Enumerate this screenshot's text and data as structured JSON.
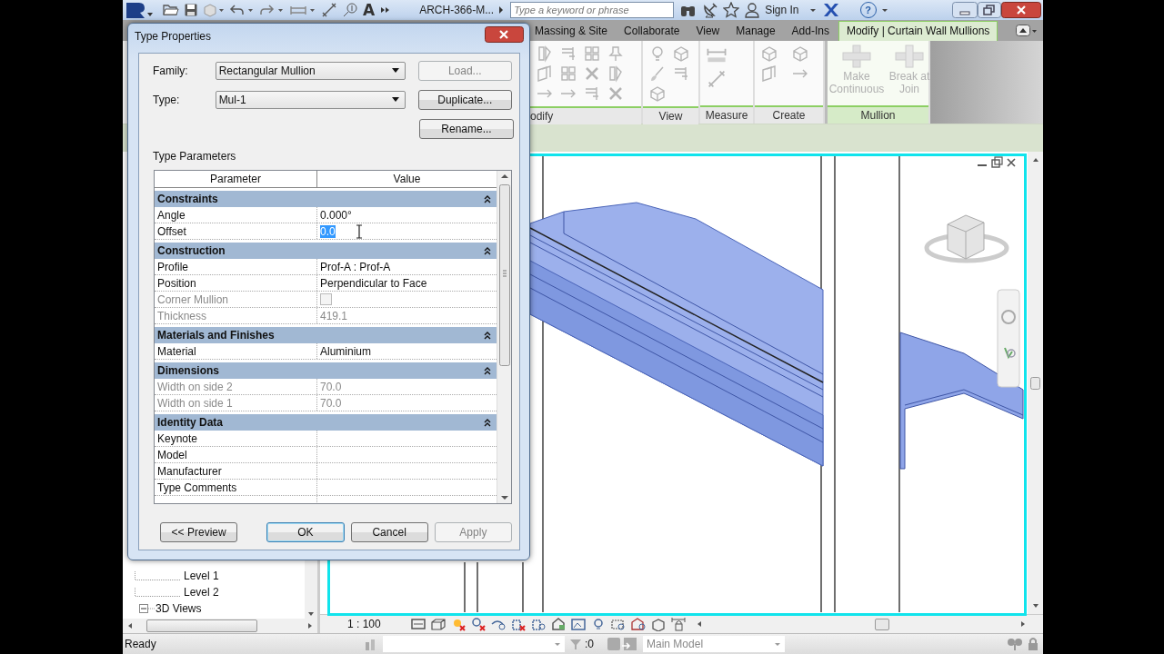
{
  "title_bar": {
    "quick_access": {
      "text_tool": "A"
    },
    "title": "ARCH-366-M...",
    "search": {
      "placeholder": "Type a keyword or phrase"
    },
    "sign_in": "Sign In",
    "help": "?"
  },
  "ribbon": {
    "tabs": [
      {
        "label": "Massing & Site",
        "selected": false
      },
      {
        "label": "Collaborate",
        "selected": false
      },
      {
        "label": "View",
        "selected": false
      },
      {
        "label": "Manage",
        "selected": false
      },
      {
        "label": "Add-Ins",
        "selected": false
      },
      {
        "label": "Modify | Curtain Wall Mullions",
        "selected": true
      }
    ],
    "panels": [
      {
        "label": "odify",
        "kind": "modify"
      },
      {
        "label": "View",
        "kind": "view"
      },
      {
        "label": "Measure",
        "kind": "measure"
      },
      {
        "label": "Create",
        "kind": "create"
      },
      {
        "label": "Mullion",
        "kind": "mullion",
        "buttons": [
          {
            "label": "Make Continuous",
            "disabled": true
          },
          {
            "label": "Break at Join",
            "disabled": true
          }
        ]
      }
    ]
  },
  "project_browser": {
    "items": [
      {
        "label": "Level 1",
        "kind": "leaf"
      },
      {
        "label": "Level 2",
        "kind": "leaf"
      },
      {
        "label": "3D Views",
        "kind": "folder",
        "expanded": true
      }
    ]
  },
  "view": {
    "scale": "1 : 100"
  },
  "status_bar": {
    "message": "Ready",
    "selection_count": ":0",
    "workset": "Main Model"
  },
  "dialog": {
    "title": "Type Properties",
    "family": {
      "label": "Family:",
      "value": "Rectangular Mullion"
    },
    "type": {
      "label": "Type:",
      "value": "Mul-1"
    },
    "side_buttons": [
      {
        "label": "Load...",
        "disabled": true
      },
      {
        "label": "Duplicate...",
        "disabled": false
      },
      {
        "label": "Rename...",
        "disabled": false
      }
    ],
    "section_label": "Type Parameters",
    "columns": [
      "Parameter",
      "Value"
    ],
    "groups": [
      {
        "title": "Constraints",
        "expanded": true,
        "rows": [
          {
            "kind": "text",
            "name": "Angle",
            "value": "0.000°",
            "disabled": false
          },
          {
            "kind": "edit",
            "name": "Offset",
            "value": "0.0",
            "disabled": false
          }
        ]
      },
      {
        "title": "Construction",
        "expanded": true,
        "rows": [
          {
            "kind": "text",
            "name": "Profile",
            "value": "Prof-A : Prof-A",
            "disabled": false
          },
          {
            "kind": "text",
            "name": "Position",
            "value": "Perpendicular to Face",
            "disabled": false
          },
          {
            "kind": "checkbox",
            "name": "Corner Mullion",
            "checked": false,
            "disabled": true
          },
          {
            "kind": "text",
            "name": "Thickness",
            "value": "419.1",
            "disabled": true
          }
        ]
      },
      {
        "title": "Materials and Finishes",
        "expanded": true,
        "rows": [
          {
            "kind": "text",
            "name": "Material",
            "value": "Aluminium",
            "disabled": false
          }
        ]
      },
      {
        "title": "Dimensions",
        "expanded": true,
        "rows": [
          {
            "kind": "text",
            "name": "Width on side 2",
            "value": "70.0",
            "disabled": true
          },
          {
            "kind": "text",
            "name": "Width on side 1",
            "value": "70.0",
            "disabled": true
          }
        ]
      },
      {
        "title": "Identity Data",
        "expanded": true,
        "rows": [
          {
            "kind": "text",
            "name": "Keynote",
            "disabled": false
          },
          {
            "kind": "text",
            "name": "Model",
            "disabled": false
          },
          {
            "kind": "text",
            "name": "Manufacturer",
            "disabled": false
          },
          {
            "kind": "text",
            "name": "Type Comments",
            "disabled": false
          }
        ]
      }
    ],
    "buttons": [
      {
        "label": "<< Preview",
        "default": false,
        "disabled": false
      },
      {
        "label": "OK",
        "default": true,
        "disabled": false
      },
      {
        "label": "Cancel",
        "default": false,
        "disabled": false
      },
      {
        "label": "Apply",
        "default": false,
        "disabled": true
      }
    ]
  }
}
